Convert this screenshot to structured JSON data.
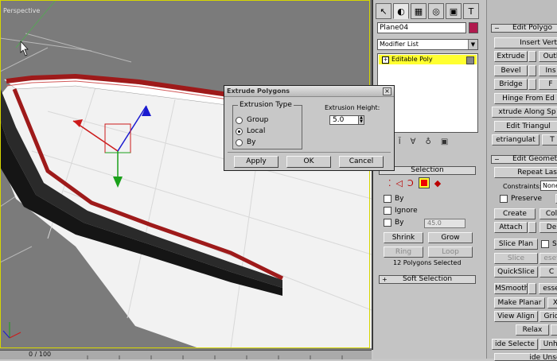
{
  "viewport": {
    "label": "Perspective"
  },
  "timeline": {
    "counter": "0 / 100"
  },
  "command_panel": {
    "tabs": [
      {
        "name": "create-tab-icon",
        "glyph": "↖"
      },
      {
        "name": "modify-tab-icon",
        "glyph": "◐"
      },
      {
        "name": "hierarchy-tab-icon",
        "glyph": "▦"
      },
      {
        "name": "motion-tab-icon",
        "glyph": "◎"
      },
      {
        "name": "display-tab-icon",
        "glyph": "▣"
      },
      {
        "name": "utilities-tab-icon",
        "glyph": "T"
      }
    ],
    "object_name": "Plane04",
    "object_color": "#b01a4e",
    "modifier_list_placeholder": "Modifier List",
    "stack_item": "Editable Poly"
  },
  "selection_rollout": {
    "title": "Selection",
    "by_vertex": "By",
    "ignore_backfacing": "Ignore",
    "by_angle": "By",
    "angle_value": "45.0",
    "shrink": "Shrink",
    "grow": "Grow",
    "ring": "Ring",
    "loop": "Loop",
    "status": "12 Polygons Selected"
  },
  "soft_selection": {
    "title": "Soft Selection"
  },
  "edit_polygons": {
    "title": "Edit Polygo",
    "insert_vertex": "Insert Vert",
    "extrude": "Extrude",
    "outline": "Outl",
    "bevel": "Bevel",
    "inset": "Ins",
    "bridge": "Bridge",
    "flip": "F",
    "hinge": "Hinge From Ed",
    "extrude_spline": "xtrude Along Sp",
    "edit_triangulation": "Edit Triangul",
    "retriangulate": "etriangulat",
    "turn": "T"
  },
  "edit_geometry": {
    "title": "Edit Geomet",
    "repeat_last": "Repeat Las",
    "constraints_label": "Constraints:",
    "constraints_value": "None",
    "preserve_uvs": "Preserve",
    "create": "Create",
    "collapse": "Col",
    "attach": "Attach",
    "detach": "De",
    "slice_plane": "Slice Plan",
    "split": "Sp",
    "slice": "Slice",
    "reset_plane": "eset",
    "quickslice": "QuickSlice",
    "cut": "C",
    "msmooth": "MSmooth",
    "tessellate": "esse",
    "make_planar": "Make Planar",
    "x": "X",
    "view_align": "View Align",
    "grid_align": "Grid",
    "relax": "Relax",
    "hide_selected": "ide Selecte",
    "unhide_all": "Unhi",
    "hide_unselected": "ide Unsel"
  },
  "extrude_dialog": {
    "title": "Extrude Polygons",
    "group_label": "Extrusion Type",
    "options": [
      "Group",
      "Local",
      "By"
    ],
    "selected_option": "Local",
    "height_label": "Extrusion Height:",
    "height_value": "5.0",
    "apply": "Apply",
    "ok": "OK",
    "cancel": "Cancel"
  }
}
